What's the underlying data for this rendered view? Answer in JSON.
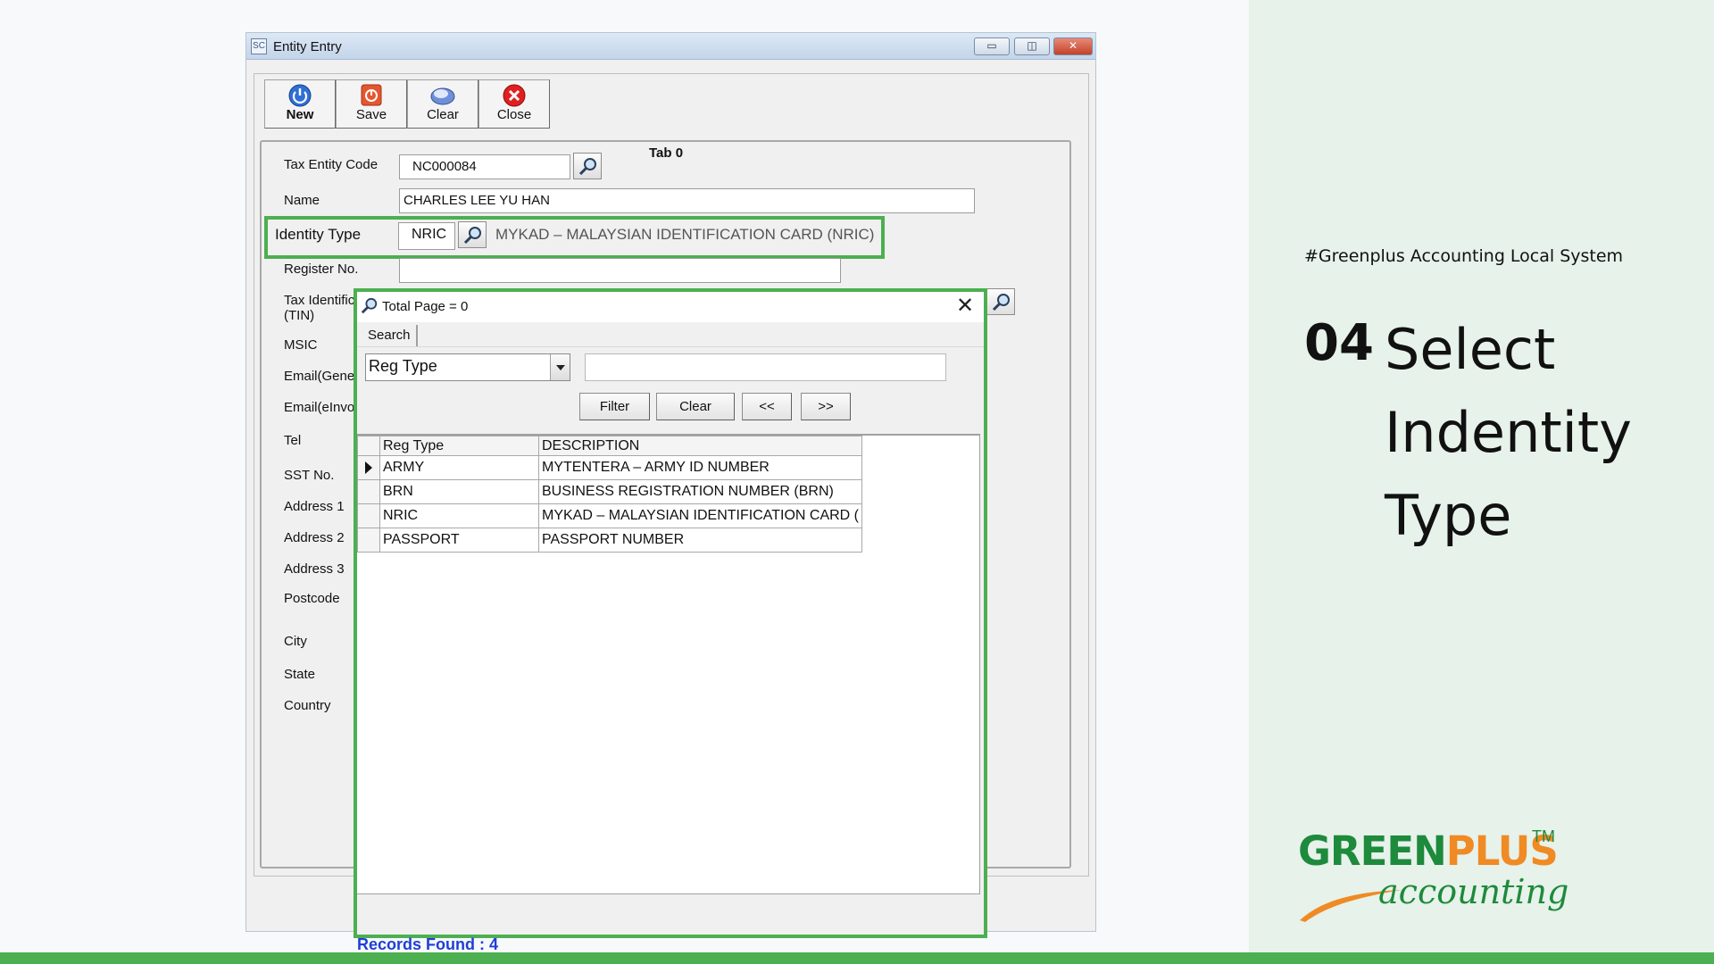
{
  "window": {
    "title": "Entity Entry",
    "icon_text": "SC",
    "min_icon": "▭",
    "max_icon": "◫",
    "close_icon": "✕"
  },
  "toolbar": {
    "new_label": "New",
    "save_label": "Save",
    "clear_label": "Clear",
    "close_label": "Close"
  },
  "tab": {
    "caption": "Tab 0"
  },
  "form": {
    "tax_entity_code_label": "Tax Entity Code",
    "tax_entity_code_value": "NC000084",
    "name_label": "Name",
    "name_value": "CHARLES LEE YU HAN",
    "identity_type_label": "Identity Type",
    "identity_type_value": "NRIC",
    "identity_type_desc": "MYKAD – MALAYSIAN IDENTIFICATION CARD (NRIC)",
    "register_no_label": "Register No.",
    "tin_label_1": "Tax Identific",
    "tin_label_2": "(TIN)",
    "msic_label": "MSIC",
    "email_general_label": "Email(Gener",
    "email_einvoice_label": "Email(eInvoi",
    "tel_label": "Tel",
    "sst_label": "SST No.",
    "address1_label": "Address 1",
    "address2_label": "Address 2",
    "address3_label": "Address 3",
    "postcode_label": "Postcode",
    "city_label": "City",
    "state_label": "State",
    "country_label": "Country"
  },
  "popup": {
    "title": "Total Page = 0",
    "close_glyph": "✕",
    "search_tab": "Search",
    "search_field": "Reg Type",
    "search_value": "",
    "filter_label": "Filter",
    "clear_label": "Clear",
    "prev_label": "<<",
    "next_label": ">>",
    "columns": [
      "Reg Type",
      "DESCRIPTION"
    ],
    "rows": [
      {
        "reg_type": "ARMY",
        "description": "MYTENTERA – ARMY ID NUMBER"
      },
      {
        "reg_type": "BRN",
        "description": "BUSINESS REGISTRATION NUMBER (BRN)"
      },
      {
        "reg_type": "NRIC",
        "description": "MYKAD – MALAYSIAN IDENTIFICATION CARD ("
      },
      {
        "reg_type": "PASSPORT",
        "description": "PASSPORT NUMBER"
      }
    ],
    "records_found": "Records Found : 4"
  },
  "guide": {
    "hashtag": "#Greenplus Accounting Local System",
    "step_number": "04",
    "step_title_1": "Select",
    "step_title_2": "Indentity",
    "step_title_3": "Type"
  },
  "logo": {
    "main_1": "GREEN",
    "main_2": "PLUS",
    "tm": "TM",
    "sub": "accounting"
  },
  "colors": {
    "highlight": "#4caf50",
    "brand_green": "#1e8a3c",
    "brand_orange": "#f08a24",
    "records_blue": "#1f3fd6"
  }
}
